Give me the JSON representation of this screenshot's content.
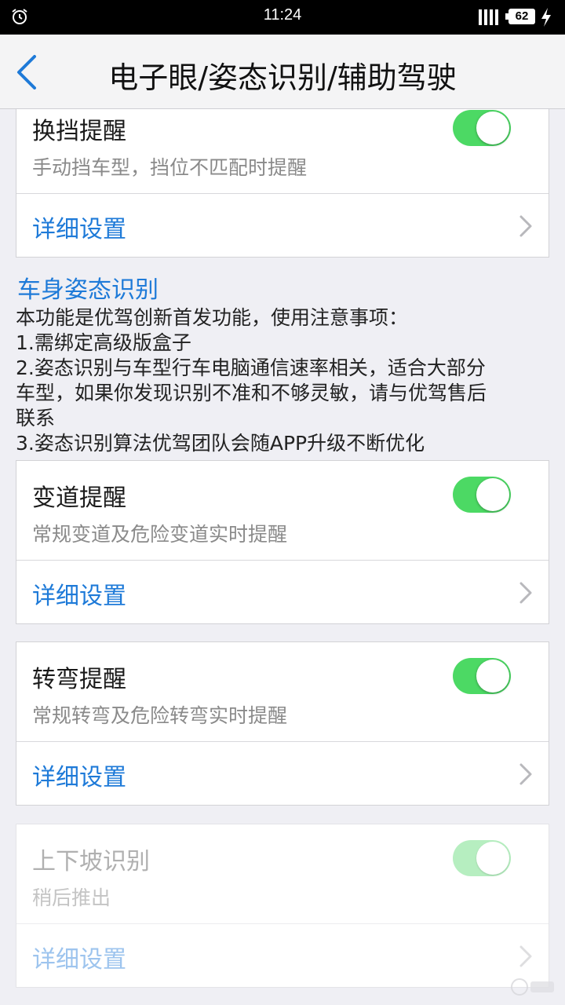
{
  "status_bar": {
    "time": "11:24",
    "battery": "62",
    "icons": [
      "alarm-icon",
      "signal-icon",
      "battery-icon",
      "charging-icon"
    ]
  },
  "nav": {
    "title": "电子眼/姿态识别/辅助驾驶",
    "back_icon": "chevron-left-icon"
  },
  "cards": {
    "gear_shift": {
      "title": "换挡提醒",
      "subtitle": "手动挡车型，挡位不匹配时提醒",
      "enabled": true,
      "detail": "详细设置"
    },
    "lane_change": {
      "title": "变道提醒",
      "subtitle": "常规变道及危险变道实时提醒",
      "enabled": true,
      "detail": "详细设置"
    },
    "turn": {
      "title": "转弯提醒",
      "subtitle": "常规转弯及危险转弯实时提醒",
      "enabled": true,
      "detail": "详细设置"
    },
    "slope": {
      "title": "上下坡识别",
      "subtitle": "稍后推出",
      "enabled": true,
      "disabled": true,
      "detail": "详细设置"
    }
  },
  "section": {
    "title": "车身姿态识别",
    "lines": [
      "本功能是优驾创新首发功能，使用注意事项：",
      "1.需绑定高级版盒子",
      "2.姿态识别与车型行车电脑通信速率相关，适合大部分",
      "车型，如果你发现识别不准和不够灵敏，请与优驾售后",
      "联系",
      "3.姿态识别算法优驾团队会随APP升级不断优化"
    ]
  },
  "colors": {
    "accent": "#1e7ad8",
    "switch_on": "#4cd964",
    "background": "#efeff4"
  }
}
